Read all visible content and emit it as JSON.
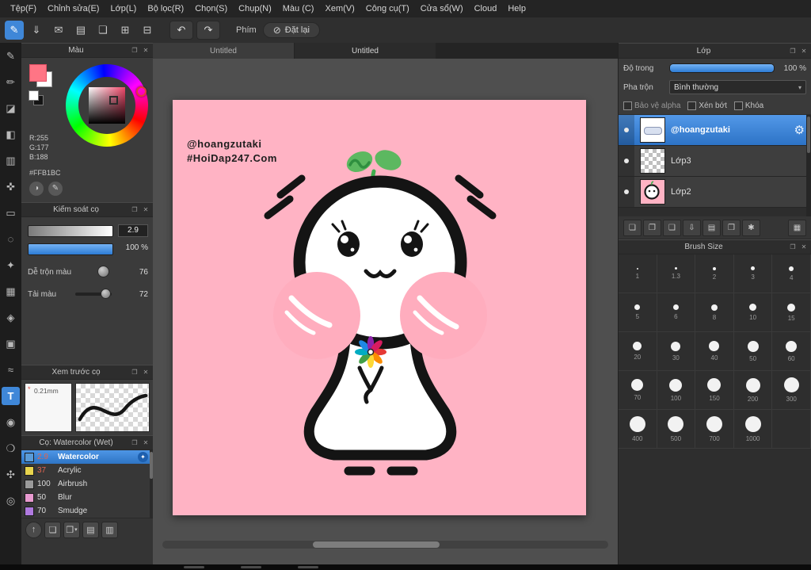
{
  "menu": {
    "items": [
      "Tệp(F)",
      "Chỉnh sửa(E)",
      "Lớp(L)",
      "Bộ lọc(R)",
      "Chọn(S)",
      "Chụp(N)",
      "Màu (C)",
      "Xem(V)",
      "Công cụ(T)",
      "Cửa sổ(W)",
      "Cloud",
      "Help"
    ]
  },
  "toolbar": {
    "phim_label": "Phím",
    "reset_label": "Đặt lại"
  },
  "icons": {
    "brush": "✎",
    "save": "⇓",
    "mail": "✉",
    "display": "▤",
    "file": "❏",
    "grid": "⊞",
    "cells": "⊟",
    "undo": "↶",
    "redo": "↷",
    "block": "⊘",
    "caret": "▾",
    "popout": "❐",
    "close": "✕",
    "gear": "⚙",
    "spark": "✦",
    "up": "↑",
    "page": "❏",
    "page2": "❐",
    "folder": "▤",
    "folder2": "▥",
    "palette_a": "◑",
    "palette_b": "✎",
    "layer_actions": [
      "❏",
      "❐",
      "❑",
      "⇩",
      "▤",
      "❒",
      "✱",
      "▦"
    ]
  },
  "tools": [
    {
      "name": "pen-tool",
      "glyph": "✎"
    },
    {
      "name": "pencil-tool",
      "glyph": "✏"
    },
    {
      "name": "eraser-tool",
      "glyph": "◪"
    },
    {
      "name": "fill-tool",
      "glyph": "◧"
    },
    {
      "name": "gradient-tool",
      "glyph": "▥"
    },
    {
      "name": "move-tool",
      "glyph": "✜"
    },
    {
      "name": "select-rect-tool",
      "glyph": "▭"
    },
    {
      "name": "lasso-tool",
      "glyph": "◌"
    },
    {
      "name": "magic-wand-tool",
      "glyph": "✦"
    },
    {
      "name": "crop-tool",
      "glyph": "▦"
    },
    {
      "name": "transform-tool",
      "glyph": "◈"
    },
    {
      "name": "stamp-tool",
      "glyph": "▣"
    },
    {
      "name": "curve-tool",
      "glyph": "≈"
    },
    {
      "name": "text-tool",
      "glyph": "T"
    },
    {
      "name": "eyedropper-tool",
      "glyph": "◉"
    },
    {
      "name": "blur-tool",
      "glyph": "❍"
    },
    {
      "name": "hand-tool",
      "glyph": "✣"
    },
    {
      "name": "zoom-tool",
      "glyph": "◎"
    }
  ],
  "tabs": [
    "Untitled",
    "Untitled"
  ],
  "canvas": {
    "credit_line1": "@hoangzutaki",
    "credit_line2": "#HoiDap247.Com"
  },
  "color_panel": {
    "title": "Màu",
    "rgb": [
      "R:255",
      "G:177",
      "B:188"
    ],
    "hex": "#FFB1BC"
  },
  "brush_control": {
    "title": "Kiểm soát cọ",
    "size_value": "2.9",
    "opacity_value": "100 %",
    "mix_label": "Dễ trộn màu",
    "mix_value": "76",
    "load_label": "Tải màu",
    "load_value": "72"
  },
  "brush_preview": {
    "title": "Xem trước cọ",
    "width_label": "0.21mm",
    "star": "*"
  },
  "brushes": {
    "title": "Cọ: Watercolor (Wet)",
    "items": [
      {
        "size": "2.9",
        "name": "Watercolor",
        "chip": "#5a9bd8"
      },
      {
        "size": "37",
        "name": "Acrylic",
        "chip": "#e8d44d"
      },
      {
        "size": "100",
        "name": "Airbrush",
        "chip": "#9a9a9a"
      },
      {
        "size": "50",
        "name": "Blur",
        "chip": "#e89ad0"
      },
      {
        "size": "70",
        "name": "Smudge",
        "chip": "#b07ae0"
      }
    ]
  },
  "layers": {
    "title": "Lớp",
    "opacity_label": "Độ trong",
    "opacity_value": "100 %",
    "blend_label": "Pha trộn",
    "blend_mode": "Bình thường",
    "checkboxes": [
      "Bảo vệ alpha",
      "Xén bớt",
      "Khóa"
    ],
    "items": [
      {
        "name": "@hoangzutaki"
      },
      {
        "name": "Lớp3"
      },
      {
        "name": "Lớp2"
      }
    ]
  },
  "brush_size": {
    "title": "Brush Size",
    "sizes": [
      1,
      1.3,
      2,
      3,
      4,
      5,
      6,
      8,
      10,
      15,
      20,
      30,
      40,
      50,
      60,
      70,
      100,
      150,
      200,
      300,
      400,
      500,
      700,
      1000
    ]
  },
  "colors": {
    "accent": "#3f87d8",
    "canvas_pink": "#ffb3c4",
    "foreground": "#FFB1BC",
    "selected_layer": "#2d73c6"
  }
}
